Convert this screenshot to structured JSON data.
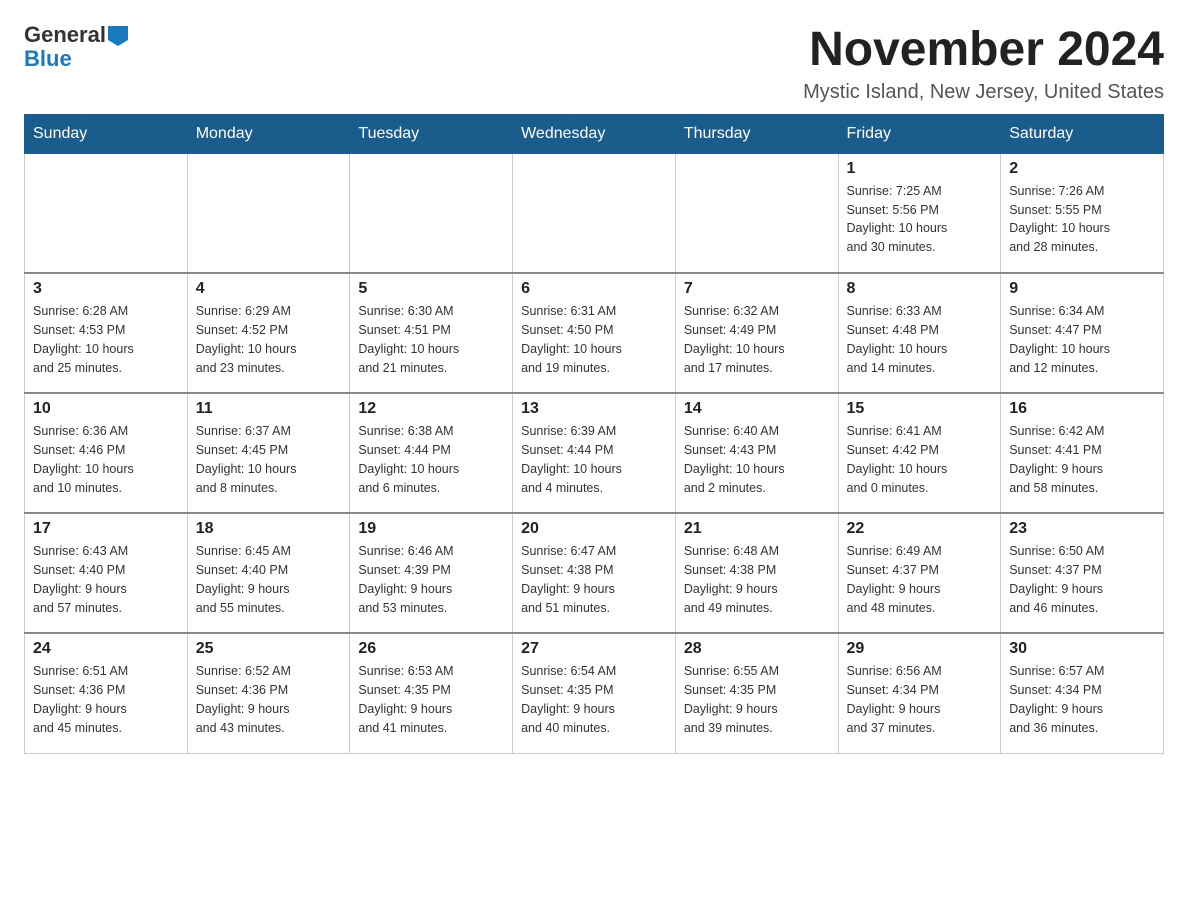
{
  "logo": {
    "general": "General",
    "blue": "Blue"
  },
  "title": {
    "month": "November 2024",
    "location": "Mystic Island, New Jersey, United States"
  },
  "weekdays": [
    "Sunday",
    "Monday",
    "Tuesday",
    "Wednesday",
    "Thursday",
    "Friday",
    "Saturday"
  ],
  "weeks": [
    [
      {
        "day": "",
        "info": ""
      },
      {
        "day": "",
        "info": ""
      },
      {
        "day": "",
        "info": ""
      },
      {
        "day": "",
        "info": ""
      },
      {
        "day": "",
        "info": ""
      },
      {
        "day": "1",
        "info": "Sunrise: 7:25 AM\nSunset: 5:56 PM\nDaylight: 10 hours\nand 30 minutes."
      },
      {
        "day": "2",
        "info": "Sunrise: 7:26 AM\nSunset: 5:55 PM\nDaylight: 10 hours\nand 28 minutes."
      }
    ],
    [
      {
        "day": "3",
        "info": "Sunrise: 6:28 AM\nSunset: 4:53 PM\nDaylight: 10 hours\nand 25 minutes."
      },
      {
        "day": "4",
        "info": "Sunrise: 6:29 AM\nSunset: 4:52 PM\nDaylight: 10 hours\nand 23 minutes."
      },
      {
        "day": "5",
        "info": "Sunrise: 6:30 AM\nSunset: 4:51 PM\nDaylight: 10 hours\nand 21 minutes."
      },
      {
        "day": "6",
        "info": "Sunrise: 6:31 AM\nSunset: 4:50 PM\nDaylight: 10 hours\nand 19 minutes."
      },
      {
        "day": "7",
        "info": "Sunrise: 6:32 AM\nSunset: 4:49 PM\nDaylight: 10 hours\nand 17 minutes."
      },
      {
        "day": "8",
        "info": "Sunrise: 6:33 AM\nSunset: 4:48 PM\nDaylight: 10 hours\nand 14 minutes."
      },
      {
        "day": "9",
        "info": "Sunrise: 6:34 AM\nSunset: 4:47 PM\nDaylight: 10 hours\nand 12 minutes."
      }
    ],
    [
      {
        "day": "10",
        "info": "Sunrise: 6:36 AM\nSunset: 4:46 PM\nDaylight: 10 hours\nand 10 minutes."
      },
      {
        "day": "11",
        "info": "Sunrise: 6:37 AM\nSunset: 4:45 PM\nDaylight: 10 hours\nand 8 minutes."
      },
      {
        "day": "12",
        "info": "Sunrise: 6:38 AM\nSunset: 4:44 PM\nDaylight: 10 hours\nand 6 minutes."
      },
      {
        "day": "13",
        "info": "Sunrise: 6:39 AM\nSunset: 4:44 PM\nDaylight: 10 hours\nand 4 minutes."
      },
      {
        "day": "14",
        "info": "Sunrise: 6:40 AM\nSunset: 4:43 PM\nDaylight: 10 hours\nand 2 minutes."
      },
      {
        "day": "15",
        "info": "Sunrise: 6:41 AM\nSunset: 4:42 PM\nDaylight: 10 hours\nand 0 minutes."
      },
      {
        "day": "16",
        "info": "Sunrise: 6:42 AM\nSunset: 4:41 PM\nDaylight: 9 hours\nand 58 minutes."
      }
    ],
    [
      {
        "day": "17",
        "info": "Sunrise: 6:43 AM\nSunset: 4:40 PM\nDaylight: 9 hours\nand 57 minutes."
      },
      {
        "day": "18",
        "info": "Sunrise: 6:45 AM\nSunset: 4:40 PM\nDaylight: 9 hours\nand 55 minutes."
      },
      {
        "day": "19",
        "info": "Sunrise: 6:46 AM\nSunset: 4:39 PM\nDaylight: 9 hours\nand 53 minutes."
      },
      {
        "day": "20",
        "info": "Sunrise: 6:47 AM\nSunset: 4:38 PM\nDaylight: 9 hours\nand 51 minutes."
      },
      {
        "day": "21",
        "info": "Sunrise: 6:48 AM\nSunset: 4:38 PM\nDaylight: 9 hours\nand 49 minutes."
      },
      {
        "day": "22",
        "info": "Sunrise: 6:49 AM\nSunset: 4:37 PM\nDaylight: 9 hours\nand 48 minutes."
      },
      {
        "day": "23",
        "info": "Sunrise: 6:50 AM\nSunset: 4:37 PM\nDaylight: 9 hours\nand 46 minutes."
      }
    ],
    [
      {
        "day": "24",
        "info": "Sunrise: 6:51 AM\nSunset: 4:36 PM\nDaylight: 9 hours\nand 45 minutes."
      },
      {
        "day": "25",
        "info": "Sunrise: 6:52 AM\nSunset: 4:36 PM\nDaylight: 9 hours\nand 43 minutes."
      },
      {
        "day": "26",
        "info": "Sunrise: 6:53 AM\nSunset: 4:35 PM\nDaylight: 9 hours\nand 41 minutes."
      },
      {
        "day": "27",
        "info": "Sunrise: 6:54 AM\nSunset: 4:35 PM\nDaylight: 9 hours\nand 40 minutes."
      },
      {
        "day": "28",
        "info": "Sunrise: 6:55 AM\nSunset: 4:35 PM\nDaylight: 9 hours\nand 39 minutes."
      },
      {
        "day": "29",
        "info": "Sunrise: 6:56 AM\nSunset: 4:34 PM\nDaylight: 9 hours\nand 37 minutes."
      },
      {
        "day": "30",
        "info": "Sunrise: 6:57 AM\nSunset: 4:34 PM\nDaylight: 9 hours\nand 36 minutes."
      }
    ]
  ]
}
